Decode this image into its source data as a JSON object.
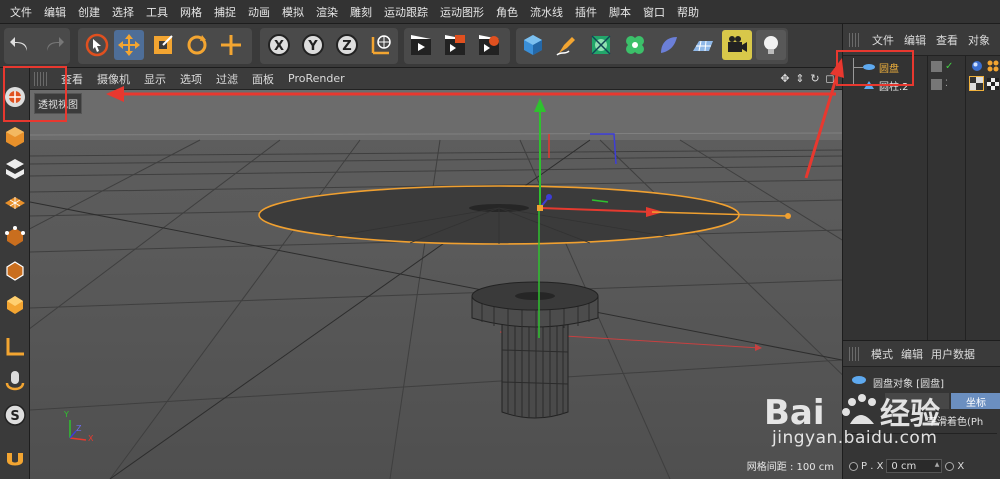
{
  "menu": [
    "文件",
    "编辑",
    "创建",
    "选择",
    "工具",
    "网格",
    "捕捉",
    "动画",
    "模拟",
    "渲染",
    "雕刻",
    "运动跟踪",
    "运动图形",
    "角色",
    "流水线",
    "插件",
    "脚本",
    "窗口",
    "帮助"
  ],
  "toolbar": {
    "icons": [
      "undo-icon",
      "redo-icon",
      "live-select-icon",
      "move-icon",
      "scale-icon",
      "rotate-icon",
      "recent-tools-icon",
      "x-axis-lock-icon",
      "y-axis-lock-icon",
      "z-axis-lock-icon",
      "world-coordinates-icon",
      "render-view-icon",
      "render-picture-viewer-icon",
      "render-settings-icon",
      "cube-icon",
      "pen-icon",
      "subdivision-icon",
      "cloner-icon",
      "deformer-icon",
      "floor-icon",
      "camera-icon",
      "light-icon"
    ]
  },
  "viewport": {
    "menu": [
      "查看",
      "摄像机",
      "显示",
      "选项",
      "过滤",
      "面板",
      "ProRender"
    ],
    "label": "透视视图",
    "grid_spacing": "网格间距 : 100 cm",
    "axes": {
      "x": "X",
      "y": "Y",
      "z": "Z"
    }
  },
  "object_manager": {
    "tabs": [
      "文件",
      "编辑",
      "查看",
      "对象"
    ],
    "objects": [
      {
        "name": "圆盘",
        "selected": true,
        "icon": "disc-icon"
      },
      {
        "name": "圆柱.2",
        "selected": false,
        "icon": "cylinder-icon"
      }
    ]
  },
  "attributes": {
    "tabs": [
      "模式",
      "编辑",
      "用户数据"
    ],
    "object_title": "圆盘对象 [圆盘]",
    "active_tab": "坐标",
    "phong_tag": "平滑着色(Ph",
    "p_x_label": "P . X",
    "p_x_value": "0 cm"
  },
  "watermark": {
    "text": "jingyan.baidu.com"
  },
  "colors": {
    "accent_blue": "#4e6e98",
    "selection_orange": "#f0b13c",
    "annotation_red": "#e8382f",
    "axis_red": "#e53a2f",
    "axis_green": "#2ec22e",
    "axis_blue": "#3d3dd8"
  }
}
